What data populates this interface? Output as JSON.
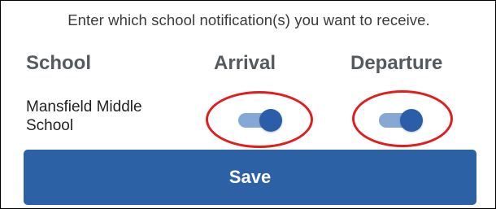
{
  "instructions": "Enter which school notification(s) you want to receive.",
  "columns": {
    "school": "School",
    "arrival": "Arrival",
    "departure": "Departure"
  },
  "rows": [
    {
      "school_name": "Mansfield Middle School",
      "arrival_enabled": true,
      "departure_enabled": true
    }
  ],
  "save_label": "Save",
  "colors": {
    "accent": "#2d61a5",
    "toggle_track_on": "#85a9d4",
    "toggle_knob_on": "#2a5ea9",
    "annotation_ring": "#e01e1e"
  }
}
